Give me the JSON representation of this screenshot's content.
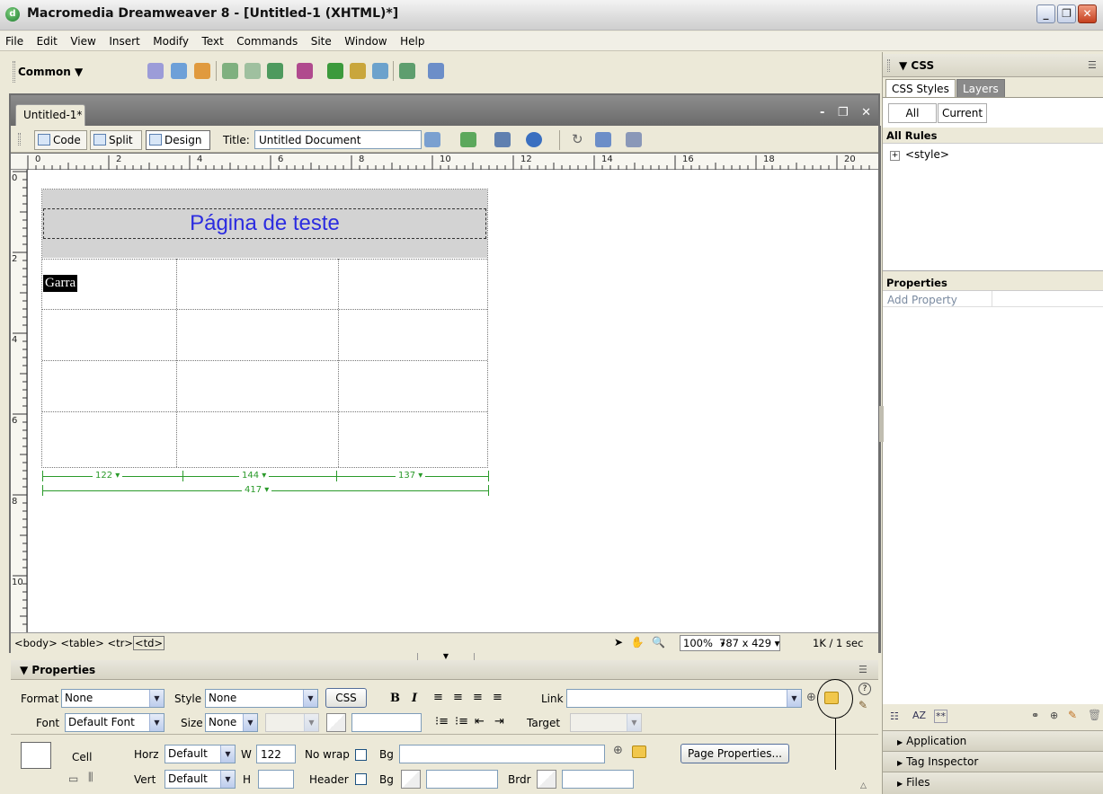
{
  "window": {
    "title": "Macromedia Dreamweaver 8 - [Untitled-1 (XHTML)*]",
    "app_icon_letter": "d"
  },
  "menu": [
    "File",
    "Edit",
    "View",
    "Insert",
    "Modify",
    "Text",
    "Commands",
    "Site",
    "Window",
    "Help"
  ],
  "insert_bar": {
    "category": "Common ▼"
  },
  "document": {
    "tab_label": "Untitled-1*",
    "view_buttons": {
      "code": "Code",
      "split": "Split",
      "design": "Design"
    },
    "title_label": "Title:",
    "title_value": "Untitled Document",
    "ruler_top": [
      "0",
      "2",
      "4",
      "6",
      "8",
      "10",
      "12",
      "14",
      "16",
      "18",
      "20"
    ],
    "ruler_left": [
      "0",
      "2",
      "4",
      "6",
      "8",
      "10"
    ],
    "heading": "Página de teste",
    "cell_text": "Garra",
    "column_widths": [
      "122 ▾",
      "144 ▾",
      "137 ▾"
    ],
    "table_width": "417 ▾"
  },
  "statusbar": {
    "tags": [
      "<body>",
      "<table>",
      "<tr>",
      "<td>"
    ],
    "zoom": "100%",
    "size": "787 x 429 ▾",
    "weight": "1K / 1 sec"
  },
  "properties": {
    "title": "▼ Properties",
    "format_label": "Format",
    "format_value": "None",
    "style_label": "Style",
    "style_value": "None",
    "css_button": "CSS",
    "bold": "B",
    "italic": "I",
    "link_label": "Link",
    "font_label": "Font",
    "font_value": "Default Font",
    "size_label": "Size",
    "size_value": "None",
    "target_label": "Target",
    "cell_label": "Cell",
    "horz_label": "Horz",
    "horz_value": "Default",
    "w_label": "W",
    "w_value": "122",
    "nowrap_label": "No wrap",
    "bg_label": "Bg",
    "page_properties_button": "Page Properties...",
    "vert_label": "Vert",
    "vert_value": "Default",
    "h_label": "H",
    "header_label": "Header",
    "bg2_label": "Bg",
    "brdr_label": "Brdr"
  },
  "css_panel": {
    "title": "▼ CSS",
    "tabs": [
      "CSS Styles",
      "Layers"
    ],
    "buttons": [
      "All",
      "Current"
    ],
    "all_rules_label": "All Rules",
    "rule": "<style>",
    "properties_label": "Properties",
    "add_property": "Add Property"
  },
  "panel_groups": [
    "Application",
    "Tag Inspector",
    "Files"
  ]
}
